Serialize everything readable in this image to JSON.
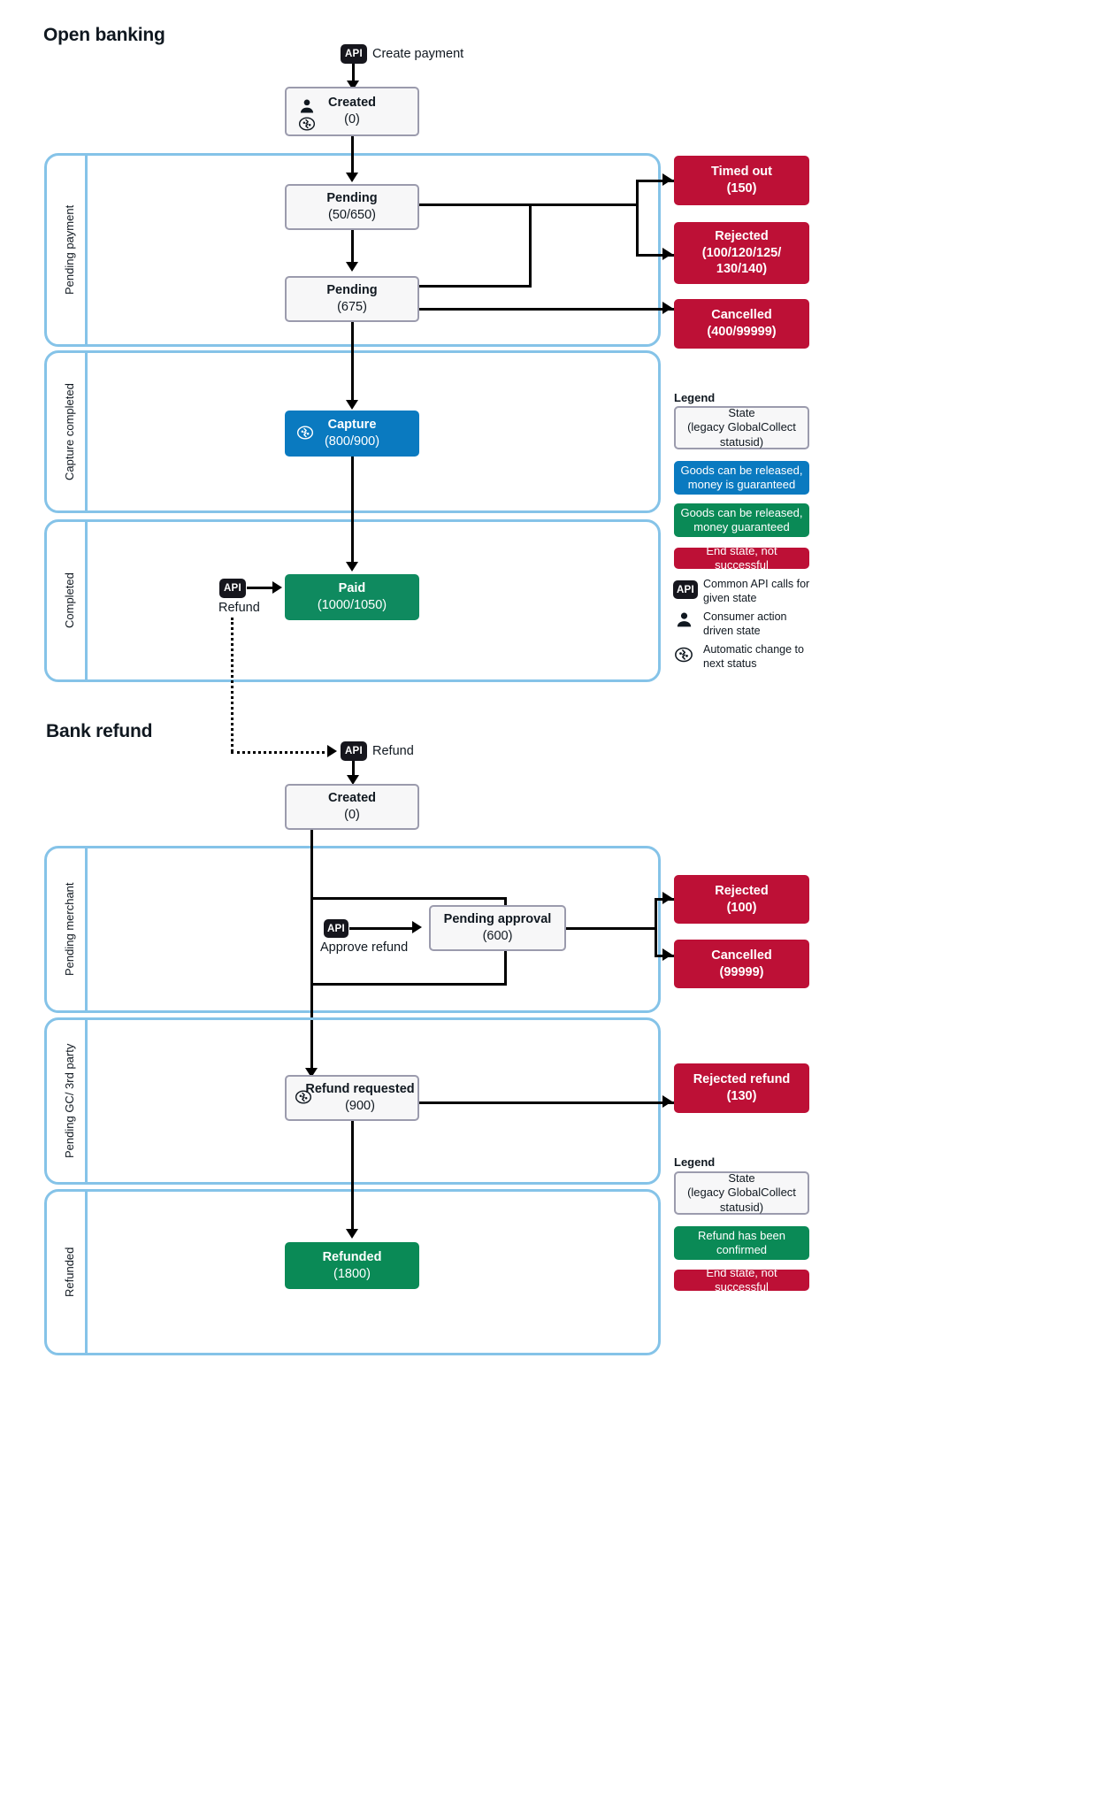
{
  "diagram": {
    "sections": [
      {
        "id": "open_banking",
        "title": "Open banking"
      },
      {
        "id": "bank_refund",
        "title": "Bank refund"
      }
    ]
  },
  "open_banking": {
    "title": "Open banking",
    "entry": {
      "badge": "API",
      "label": "Create payment"
    },
    "lanes": [
      {
        "label": "Pending payment"
      },
      {
        "label": "Capture completed"
      },
      {
        "label": "Completed"
      }
    ],
    "nodes": {
      "created": {
        "name": "Created",
        "code": "(0)"
      },
      "pending1": {
        "name": "Pending",
        "code": "(50/650)"
      },
      "pending2": {
        "name": "Pending",
        "code": "(675)"
      },
      "capture": {
        "name": "Capture",
        "code": "(800/900)"
      },
      "paid": {
        "name": "Paid",
        "code": "(1000/1050)"
      },
      "timed_out": {
        "name": "Timed out",
        "code": "(150)"
      },
      "rejected": {
        "name": "Rejected",
        "code": "(100/120/125/",
        "code2": "130/140)"
      },
      "cancelled": {
        "name": "Cancelled",
        "code": "(400/99999)"
      }
    },
    "refund_call": {
      "badge": "API",
      "label": "Refund"
    }
  },
  "bank_refund": {
    "title": "Bank refund",
    "entry": {
      "badge": "API",
      "label": "Refund"
    },
    "lanes": [
      {
        "label": "Pending merchant"
      },
      {
        "label": "Pending GC/ 3rd party"
      },
      {
        "label": "Refunded"
      }
    ],
    "nodes": {
      "created": {
        "name": "Created",
        "code": "(0)"
      },
      "pending_appr": {
        "name": "Pending approval",
        "code": "(600)"
      },
      "refund_req": {
        "name": "Refund requested",
        "code": "(900)"
      },
      "refunded": {
        "name": "Refunded",
        "code": "(1800)"
      },
      "rejected": {
        "name": "Rejected",
        "code": "(100)"
      },
      "cancelled": {
        "name": "Cancelled",
        "code": "(99999)"
      },
      "rejected_refund": {
        "name": "Rejected refund",
        "code": "(130)"
      }
    },
    "approve_call": {
      "badge": "API",
      "label": "Approve refund"
    }
  },
  "legend_payment": {
    "title": "Legend",
    "state": {
      "l1": "State",
      "l2": "(legacy GlobalCollect",
      "l3": "statusid)"
    },
    "blue": {
      "l1": "Goods can be released,",
      "l2": "money is guaranteed"
    },
    "green": {
      "l1": "Goods can be released,",
      "l2": "money guaranteed"
    },
    "red": {
      "l1": "End state, not successful"
    },
    "rows": [
      {
        "icon": "api-icon",
        "badge": "API",
        "l1": "Common API calls for",
        "l2": "given state"
      },
      {
        "icon": "person-icon",
        "l1": "Consumer action driven",
        "l2": "state"
      },
      {
        "icon": "auto-change-icon",
        "l1": "Automatic change to",
        "l2": "next status"
      }
    ]
  },
  "legend_refund": {
    "title": "Legend",
    "state": {
      "l1": "State",
      "l2": "(legacy GlobalCollect",
      "l3": "statusid)"
    },
    "green": {
      "l1": "Refund has been",
      "l2": "confirmed"
    },
    "red": {
      "l1": "End state, not successful"
    }
  },
  "colors": {
    "lane_border": "#85c3e8",
    "state_border": "#9b9bad",
    "state_fill": "#f7f7f8",
    "blue": "#0a7ac0",
    "green": "#0f8a5f",
    "green_alt": "#0a8a56",
    "red": "#bd1036",
    "badge": "#16161d",
    "text": "#101820"
  }
}
